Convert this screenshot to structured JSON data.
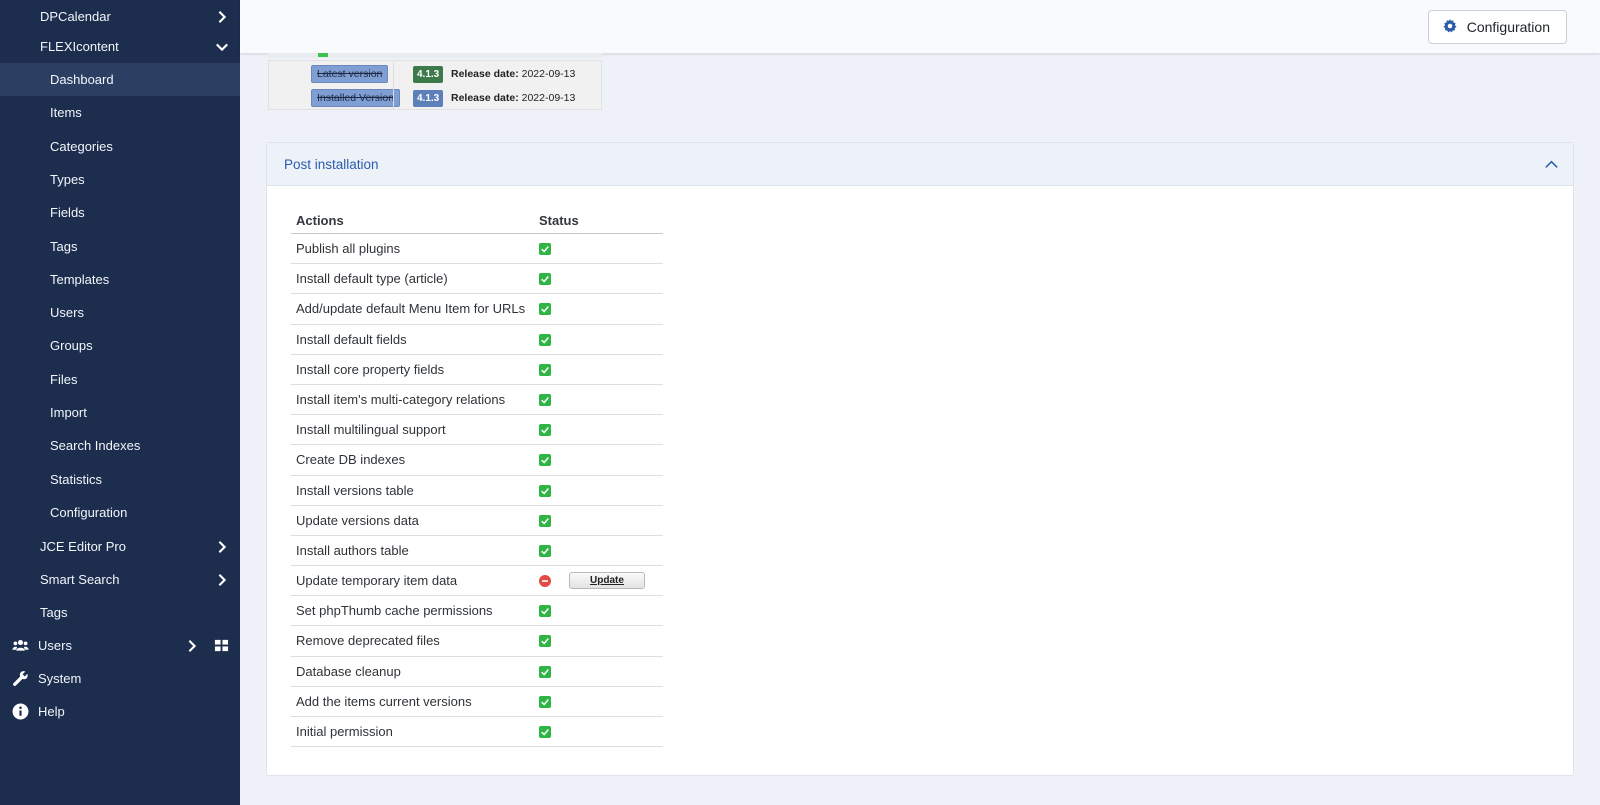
{
  "sidebar": {
    "dpcalendar": "DPCalendar",
    "flexicontent": "FLEXIcontent",
    "sub_items": [
      "Dashboard",
      "Items",
      "Categories",
      "Types",
      "Fields",
      "Tags",
      "Templates",
      "Users",
      "Groups",
      "Files",
      "Import",
      "Search Indexes",
      "Statistics",
      "Configuration"
    ],
    "jce": "JCE Editor Pro",
    "smart_search": "Smart Search",
    "tags": "Tags",
    "users": "Users",
    "system": "System",
    "help": "Help",
    "active_item": "Dashboard"
  },
  "header": {
    "config_label": "Configuration"
  },
  "versions": {
    "latest_tag": "Latest version",
    "latest_num": "4.1.3",
    "installed_tag": "Installed Version",
    "installed_num": "4.1.3",
    "release_label": "Release date:",
    "latest_date": "2022-09-13",
    "installed_date": "2022-09-13"
  },
  "post_install": {
    "title": "Post installation",
    "col_actions": "Actions",
    "col_status": "Status",
    "update_label": "Update",
    "rows": [
      {
        "action": "Publish all plugins",
        "status": "ok"
      },
      {
        "action": "Install default type (article)",
        "status": "ok"
      },
      {
        "action": "Add/update default Menu Item for URLs",
        "status": "ok"
      },
      {
        "action": "Install default fields",
        "status": "ok"
      },
      {
        "action": "Install core property fields",
        "status": "ok"
      },
      {
        "action": "Install item's multi-category relations",
        "status": "ok"
      },
      {
        "action": "Install multilingual support",
        "status": "ok"
      },
      {
        "action": "Create DB indexes",
        "status": "ok"
      },
      {
        "action": "Install versions table",
        "status": "ok"
      },
      {
        "action": "Update versions data",
        "status": "ok"
      },
      {
        "action": "Install authors table",
        "status": "ok"
      },
      {
        "action": "Update temporary item data",
        "status": "error"
      },
      {
        "action": "Set phpThumb cache permissions",
        "status": "ok"
      },
      {
        "action": "Remove deprecated files",
        "status": "ok"
      },
      {
        "action": "Database cleanup",
        "status": "ok"
      },
      {
        "action": "Add the items current versions",
        "status": "ok"
      },
      {
        "action": "Initial permission",
        "status": "ok"
      }
    ]
  },
  "colors": {
    "sidebar_bg": "#1c2d4e",
    "accent": "#2a5caa",
    "ok": "#2fb543",
    "error": "#e24a45"
  }
}
